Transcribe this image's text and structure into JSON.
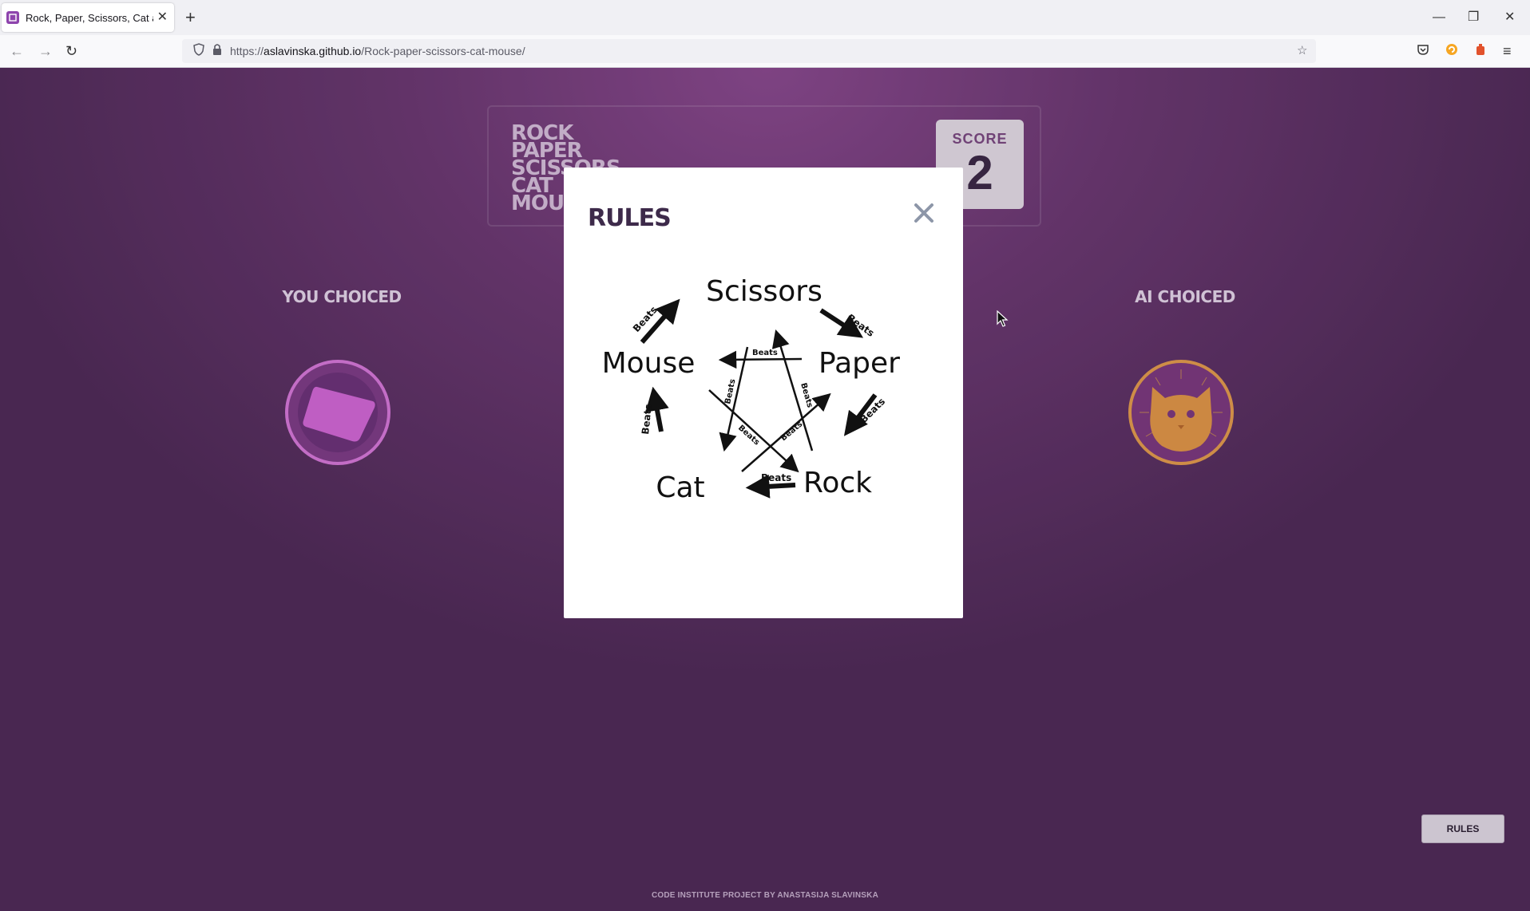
{
  "browser": {
    "tab_title": "Rock, Paper, Scissors, Cat and Mouse",
    "url_prefix": "https://",
    "url_host": "aslavinska.github.io",
    "url_path": "/Rock-paper-scissors-cat-mouse/",
    "icons": {
      "back": "back-arrow-icon",
      "forward": "forward-arrow-icon",
      "reload": "reload-icon",
      "shield": "shield-icon",
      "lock": "lock-icon",
      "bookmark": "star-icon",
      "pocket": "pocket-icon",
      "extension1": "extension-icon",
      "extension2": "extension-icon",
      "menu": "hamburger-menu-icon"
    }
  },
  "game": {
    "title_lines": [
      "ROCK",
      "PAPER",
      "SCISSORS",
      "CAT",
      "MOUSE"
    ],
    "score_label": "SCORE",
    "score_value": "2",
    "player_label": "YOU CHOICED",
    "ai_label": "AI CHOICED",
    "player_choice": "paper",
    "ai_choice": "cat",
    "rules_button": "RULES",
    "footer": "CODE INSTITUTE PROJECT BY ANASTASIJA SLAVINSKA"
  },
  "modal": {
    "title": "RULES",
    "diagram": {
      "nodes": [
        "Scissors",
        "Paper",
        "Rock",
        "Cat",
        "Mouse"
      ],
      "edge_label": "Beats"
    }
  },
  "colors": {
    "page_background": "#6a3a70",
    "player_ring": "#d97bdb",
    "ai_ring": "#e5a04a",
    "modal_title": "#3d2a4a"
  }
}
